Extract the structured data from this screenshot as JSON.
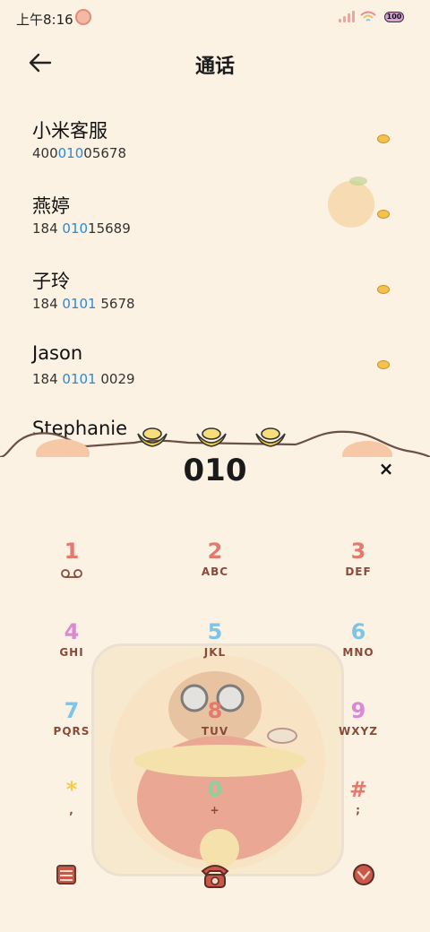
{
  "status_bar": {
    "time": "上午8:16",
    "battery": "100"
  },
  "header": {
    "title": "通话"
  },
  "contacts": [
    {
      "name": "小米客服",
      "num_pre": "400",
      "num_hl": "010",
      "num_post": "05678"
    },
    {
      "name": "燕婷",
      "num_pre": "184 ",
      "num_hl": "010",
      "num_post": "15689"
    },
    {
      "name": "子玲",
      "num_pre": "184 ",
      "num_hl": "0101",
      "num_post": " 5678"
    },
    {
      "name": "Jason",
      "num_pre": "184 ",
      "num_hl": "0101",
      "num_post": " 0029"
    }
  ],
  "partial_contact": "Stephanie",
  "dialer": {
    "digits": "010",
    "clear_symbol": "×",
    "keys": [
      {
        "digit": "1",
        "letters": "",
        "color": "#e27a6f"
      },
      {
        "digit": "2",
        "letters": "ABC",
        "color": "#e27a6f"
      },
      {
        "digit": "3",
        "letters": "DEF",
        "color": "#e27a6f"
      },
      {
        "digit": "4",
        "letters": "GHI",
        "color": "#d98ad3"
      },
      {
        "digit": "5",
        "letters": "JKL",
        "color": "#7fc4e6"
      },
      {
        "digit": "6",
        "letters": "MNO",
        "color": "#7fc4e6"
      },
      {
        "digit": "7",
        "letters": "PQRS",
        "color": "#7fc4e6"
      },
      {
        "digit": "8",
        "letters": "TUV",
        "color": "#e27a6f"
      },
      {
        "digit": "9",
        "letters": "WXYZ",
        "color": "#d98ad3"
      },
      {
        "digit": "*",
        "letters": ",",
        "color": "#f2cc4a"
      },
      {
        "digit": "0",
        "letters": "+",
        "color": "#8fcf9a"
      },
      {
        "digit": "#",
        "letters": ";",
        "color": "#e27a6f"
      }
    ]
  },
  "icons": {
    "voicemail": "voicemail-icon",
    "menu": "contacts-menu-icon",
    "call": "phone-call-icon",
    "collapse": "collapse-keypad-icon"
  }
}
